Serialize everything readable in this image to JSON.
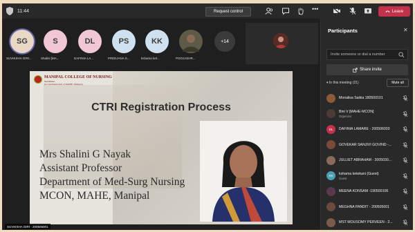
{
  "topbar": {
    "time": "11:44",
    "request_control": "Request control",
    "leave": "Leave"
  },
  "strip": {
    "avatars": [
      {
        "initials": "SG",
        "label": "SUVIKSHA GIRI...",
        "color": "#e9d8c6"
      },
      {
        "initials": "S",
        "label": "Shalini [MA...",
        "color": "#f1c7d6"
      },
      {
        "initials": "DL",
        "label": "DAFINIA LA...",
        "color": "#f1c7d6"
      },
      {
        "initials": "PS",
        "label": "PREEJANA S...",
        "color": "#cfe0ee"
      },
      {
        "initials": "KK",
        "label": "kshama ket...",
        "color": "#cfe0ee"
      },
      {
        "initials": "",
        "label": "POOJASHR...",
        "color": "#5e5a48"
      }
    ],
    "more": "+14"
  },
  "slide": {
    "logo_title_1": "MANIPAL COLLEGE OF NURSING",
    "logo_title_2": "MANIPAL",
    "logo_sub": "(A constituent unit of MAHE, Manipal)",
    "heading": "CTRI Registration Process",
    "lines": [
      "Mrs Shalini G Nayak",
      "Assistant Professor",
      "Department of Med-Surg Nursing",
      "MCON, MAHE, Manipal"
    ]
  },
  "name_tag": "SUVIKSHA GIRI - 200505001",
  "panel": {
    "title": "Participants",
    "invite_placeholder": "Invite someone or dial a number",
    "share_invite": "Share invite",
    "in_meeting": "In this meeting (21)",
    "mute_all": "Mute all",
    "participants": [
      {
        "name": "Monalisa Saikia 180500101",
        "role": "",
        "color": "#8a5a3a"
      },
      {
        "name": "Bini V [MAHE-MCON]",
        "role": "Organizer",
        "color": "#4a3a3a"
      },
      {
        "name": "DAFINIA LAMARE - 200506003",
        "role": "",
        "color": "#c4314b",
        "initials": "DL"
      },
      {
        "name": "GOVEKAR SANJIVI GOVIND -...",
        "role": "",
        "color": "#7a4a3a"
      },
      {
        "name": "JULLIET ABRAHAM - 2005030...",
        "role": "",
        "color": "#8a6a5a"
      },
      {
        "name": "kshama ketekani (Guest)",
        "role": "Guest",
        "color": "#4aa0b0",
        "initials": "KK"
      },
      {
        "name": "MEENA KONSAM -190500106",
        "role": "",
        "color": "#5a3a4a"
      },
      {
        "name": "MEGHNA PANDIT - 200505001",
        "role": "",
        "color": "#6a4a3a"
      },
      {
        "name": "MST MOUSOMY PERVEEN - 2...",
        "role": "",
        "color": "#7a5a4a"
      }
    ]
  },
  "colors": {
    "leave": "#c4314b",
    "accent": "#6264a7"
  }
}
